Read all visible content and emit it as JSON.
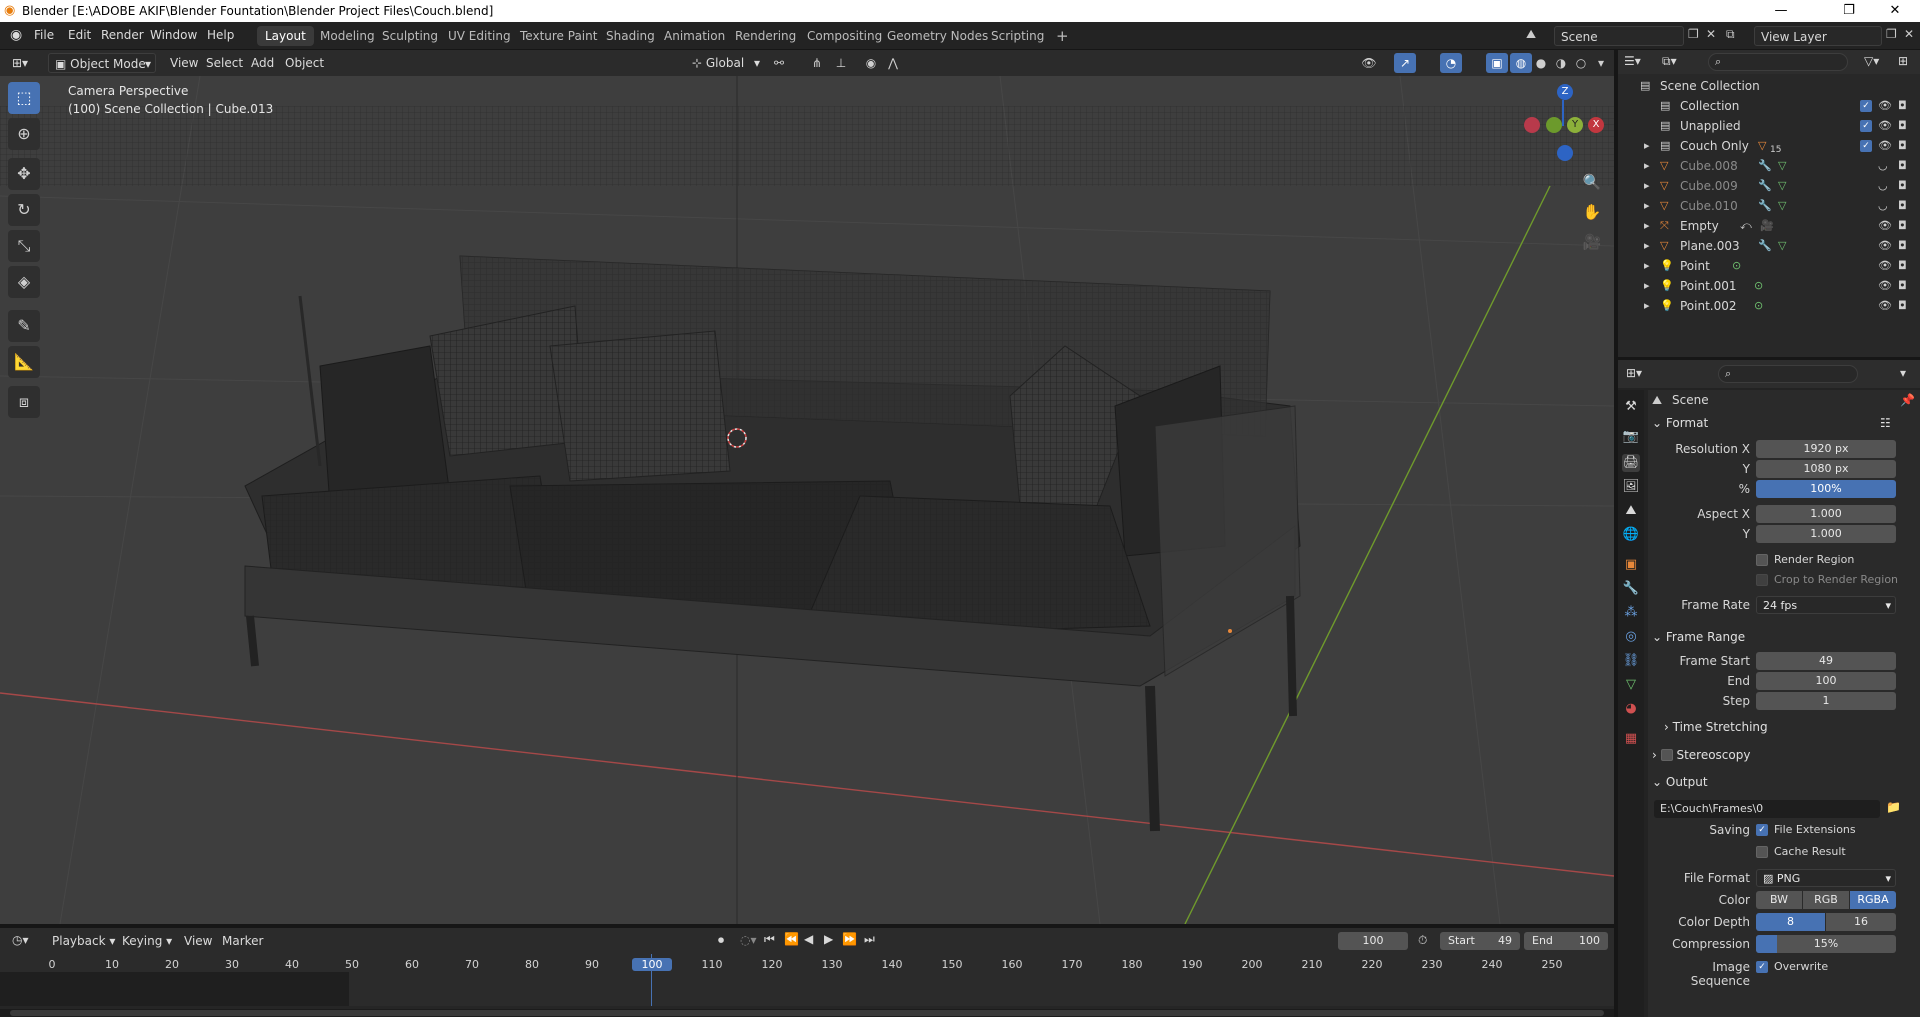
{
  "window": {
    "title": "Blender [E:\\ADOBE AKIF\\Blender Fountation\\Blender Project Files\\Couch.blend]"
  },
  "menus": [
    "File",
    "Edit",
    "Render",
    "Window",
    "Help"
  ],
  "workspaces": [
    "Layout",
    "Modeling",
    "Sculpting",
    "UV Editing",
    "Texture Paint",
    "Shading",
    "Animation",
    "Rendering",
    "Compositing",
    "Geometry Nodes",
    "Scripting"
  ],
  "scene_selector": "Scene",
  "view_layer": "View Layer",
  "viewport_header": {
    "mode": "Object Mode",
    "view": "View",
    "select": "Select",
    "add": "Add",
    "object": "Object",
    "orientation": "Global"
  },
  "viewport": {
    "perspective": "Camera Perspective",
    "collection_info": "(100) Scene Collection | Cube.013"
  },
  "gizmo": {
    "z": "Z",
    "y": "Y",
    "x": "X"
  },
  "outliner": {
    "items": [
      {
        "name": "Scene Collection",
        "dim": false
      },
      {
        "name": "Collection",
        "dim": false
      },
      {
        "name": "Unapplied",
        "dim": false
      },
      {
        "name": "Couch Only",
        "dim": false
      },
      {
        "name": "Cube.008",
        "dim": true
      },
      {
        "name": "Cube.009",
        "dim": true
      },
      {
        "name": "Cube.010",
        "dim": true
      },
      {
        "name": "Empty",
        "dim": false
      },
      {
        "name": "Plane.003",
        "dim": false
      },
      {
        "name": "Point",
        "dim": false
      },
      {
        "name": "Point.001",
        "dim": false
      },
      {
        "name": "Point.002",
        "dim": false
      }
    ],
    "badge": "15"
  },
  "properties": {
    "context": "Scene",
    "format": {
      "title": "Format",
      "res_x_label": "Resolution X",
      "res_x": "1920 px",
      "y_label": "Y",
      "res_y": "1080 px",
      "pct_label": "%",
      "pct": "100%",
      "aspect_x_label": "Aspect X",
      "aspect_x": "1.000",
      "aspect_y": "1.000",
      "render_region": "Render Region",
      "crop": "Crop to Render Region",
      "fps_label": "Frame Rate",
      "fps": "24 fps"
    },
    "frame_range": {
      "title": "Frame Range",
      "start_label": "Frame Start",
      "start": "49",
      "end_label": "End",
      "end": "100",
      "step_label": "Step",
      "step": "1"
    },
    "time_stretching": "Time Stretching",
    "stereoscopy": "Stereoscopy",
    "output": {
      "title": "Output",
      "path": "E:\\Couch\\Frames\\0",
      "saving_label": "Saving",
      "file_ext": "File Extensions",
      "cache": "Cache Result",
      "format_label": "File Format",
      "format": "PNG",
      "color_label": "Color",
      "bw": "BW",
      "rgb": "RGB",
      "rgba": "RGBA",
      "depth_label": "Color Depth",
      "d8": "8",
      "d16": "16",
      "compression_label": "Compression",
      "compression": "15%",
      "compression_fraction": 0.15,
      "seq_label": "Image Sequence",
      "overwrite": "Overwrite"
    }
  },
  "timeline": {
    "playback": "Playback",
    "keying": "Keying",
    "view": "View",
    "marker": "Marker",
    "current": "100",
    "start_label": "Start",
    "start": "49",
    "end_label": "End",
    "end": "100",
    "ticks": [
      "0",
      "10",
      "20",
      "30",
      "40",
      "50",
      "60",
      "70",
      "80",
      "90",
      "100",
      "110",
      "120",
      "130",
      "140",
      "150",
      "160",
      "170",
      "180",
      "190",
      "200",
      "210",
      "220",
      "230",
      "240",
      "250"
    ]
  },
  "colors": {
    "accent": "#4772b3",
    "axis_x": "#a54848",
    "axis_y": "#6f9a2c",
    "outline_orange": "#e8883a"
  }
}
